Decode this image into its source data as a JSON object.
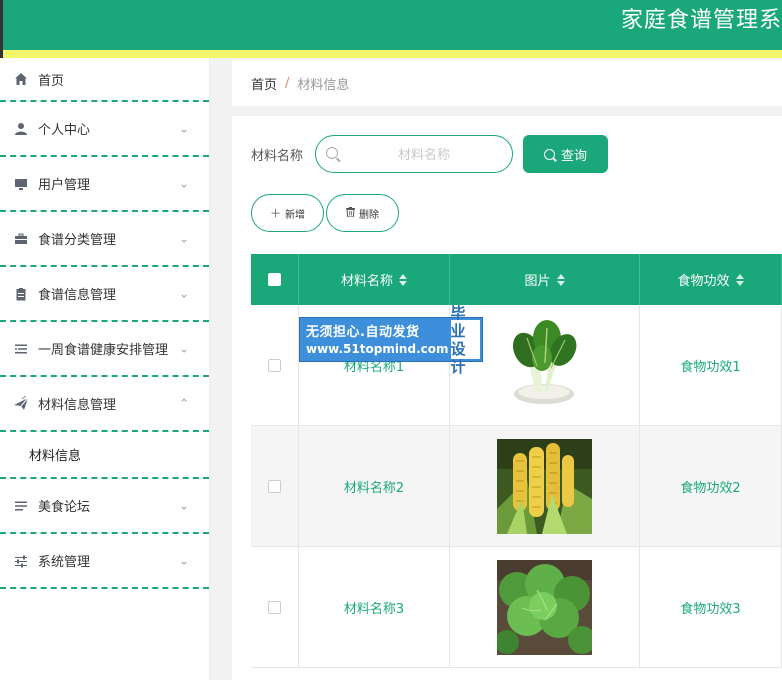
{
  "header": {
    "title": "家庭食谱管理系"
  },
  "sidebar": {
    "items": [
      {
        "label": "首页",
        "icon": "home-icon",
        "chevron": ""
      },
      {
        "label": "个人中心",
        "icon": "user-icon",
        "chevron": "⌄"
      },
      {
        "label": "用户管理",
        "icon": "monitor-icon",
        "chevron": "⌄"
      },
      {
        "label": "食谱分类管理",
        "icon": "briefcase-icon",
        "chevron": "⌄"
      },
      {
        "label": "食谱信息管理",
        "icon": "clipboard-icon",
        "chevron": "⌄"
      },
      {
        "label": "一周食谱健康安排管理",
        "icon": "list-icon",
        "chevron": "⌄"
      },
      {
        "label": "材料信息管理",
        "icon": "paper-plane-icon",
        "chevron": "⌃"
      },
      {
        "label": "材料信息"
      },
      {
        "label": "美食论坛",
        "icon": "list-icon",
        "chevron": "⌄"
      },
      {
        "label": "系统管理",
        "icon": "sliders-icon",
        "chevron": "⌄"
      }
    ]
  },
  "breadcrumb": {
    "home": "首页",
    "sep": "/",
    "current": "材料信息"
  },
  "search": {
    "label": "材料名称",
    "placeholder": "材料名称",
    "value": "",
    "button": "查询"
  },
  "actions": {
    "add": "新增",
    "delete": "删除"
  },
  "table": {
    "columns": [
      "材料名称",
      "图片",
      "食物功效"
    ],
    "rows": [
      {
        "name": "材料名称1",
        "image": "bok-choy-image",
        "effect": "食物功效1"
      },
      {
        "name": "材料名称2",
        "image": "corn-image",
        "effect": "食物功效2"
      },
      {
        "name": "材料名称3",
        "image": "lettuce-image",
        "effect": "食物功效3"
      }
    ]
  },
  "watermark": {
    "line1": "无须担心.自动发货",
    "line2": "www.51topmind.com",
    "badge1": "毕业",
    "badge2": "设计"
  },
  "colors": {
    "primary": "#1aa87b",
    "stripe": "#f3f56a"
  }
}
